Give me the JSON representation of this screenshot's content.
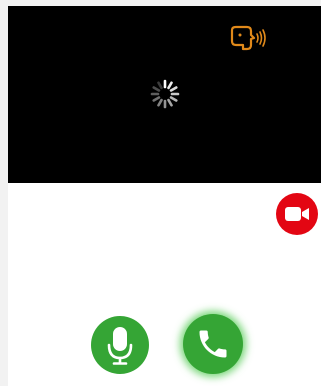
{
  "video_view": {
    "state": "loading",
    "background_color": "#000000",
    "loading_icon": "spinner-icon",
    "speaker_icon": "speaker-talking-icon",
    "speaker_icon_color": "#e0891a"
  },
  "controls": {
    "camera_toggle": {
      "icon": "video-camera-icon",
      "color": "#e30613"
    },
    "mic_button": {
      "icon": "microphone-icon",
      "color": "#35a535"
    },
    "call_button": {
      "icon": "phone-icon",
      "color": "#35a535",
      "active": true
    }
  }
}
